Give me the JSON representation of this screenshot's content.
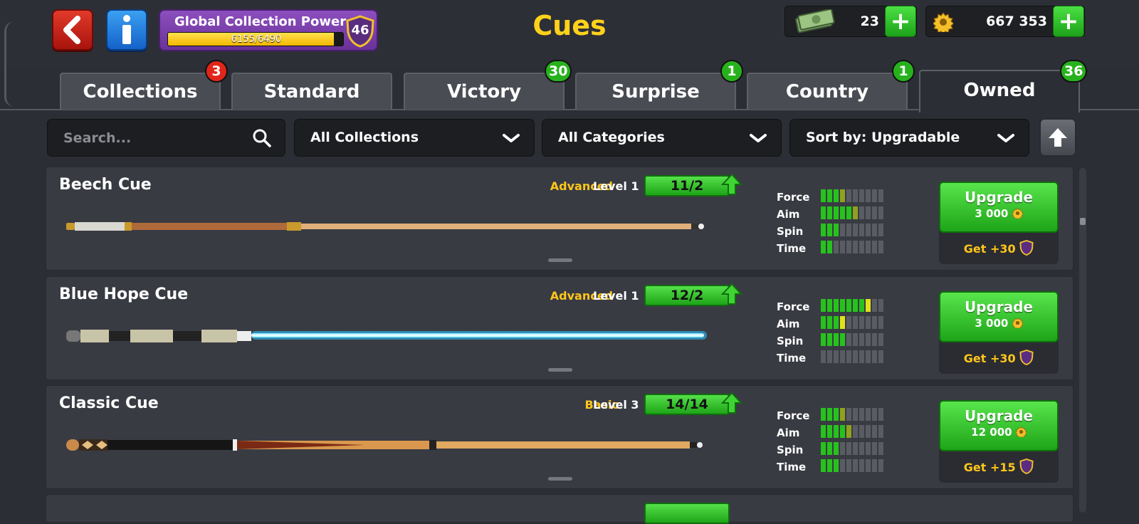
{
  "header": {
    "title": "Cues",
    "collection_power": {
      "label": "Global Collection Power",
      "value_text": "6155/6490",
      "progress": 0.948,
      "level": "46"
    },
    "cash": {
      "value": "23"
    },
    "coins": {
      "value": "667 353"
    }
  },
  "tabs": [
    {
      "label": "Collections",
      "badge": "3",
      "badge_color": "#e0261a"
    },
    {
      "label": "Standard",
      "badge": ""
    },
    {
      "label": "Victory",
      "badge": "30",
      "badge_color": "#27b21d"
    },
    {
      "label": "Surprise",
      "badge": "1",
      "badge_color": "#27b21d"
    },
    {
      "label": "Country",
      "badge": "1",
      "badge_color": "#27b21d"
    },
    {
      "label": "Owned",
      "badge": "36",
      "badge_color": "#27b21d",
      "active": true
    }
  ],
  "filters": {
    "search_placeholder": "Search...",
    "collections": "All Collections",
    "categories": "All Categories",
    "sort": "Sort by: Upgradable"
  },
  "stat_labels": [
    "Force",
    "Aim",
    "Spin",
    "Time"
  ],
  "cues": [
    {
      "name": "Beech Cue",
      "rarity": "Advanced",
      "level": "Level 1",
      "progress": "11/2",
      "stats": {
        "force": [
          3,
          1
        ],
        "aim": [
          5,
          1
        ],
        "spin": [
          3,
          0
        ],
        "time": [
          2,
          0
        ]
      },
      "upgrade": {
        "label": "Upgrade",
        "cost": "3 000",
        "get": "Get +30"
      }
    },
    {
      "name": "Blue Hope Cue",
      "rarity": "Advanced",
      "level": "Level 1",
      "progress": "12/2",
      "stats": {
        "force": [
          7,
          1
        ],
        "aim": [
          3,
          1
        ],
        "spin": [
          4,
          0
        ],
        "time": [
          0,
          0
        ]
      },
      "upgrade": {
        "label": "Upgrade",
        "cost": "3 000",
        "get": "Get +30"
      }
    },
    {
      "name": "Classic Cue",
      "rarity": "Basic",
      "level": "Level 3",
      "progress": "14/14",
      "stats": {
        "force": [
          3,
          1
        ],
        "aim": [
          4,
          1
        ],
        "spin": [
          3,
          0
        ],
        "time": [
          3,
          0
        ]
      },
      "upgrade": {
        "label": "Upgrade",
        "cost": "12 000",
        "get": "Get +15"
      }
    }
  ],
  "colors": {
    "accent_green": "#27c21d",
    "title_yellow": "#ffd21a",
    "rarity_yellow": "#ffc61a",
    "stat_yellow": "#e2e21a"
  }
}
